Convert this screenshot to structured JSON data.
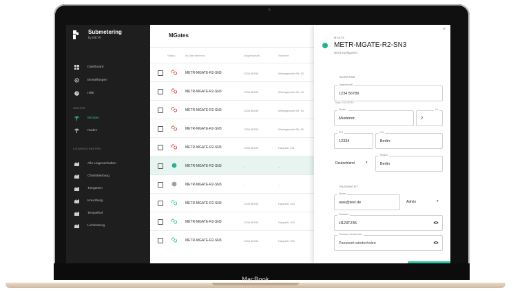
{
  "device": {
    "label": "MacBook"
  },
  "brand": {
    "title": "Submetering",
    "subtitle": "by METR"
  },
  "sidebar": {
    "items": [
      {
        "label": "Dashboard",
        "icon": "dashboard-icon"
      },
      {
        "label": "Einstellungen",
        "icon": "gear-icon"
      },
      {
        "label": "Hilfe",
        "icon": "help-icon"
      }
    ],
    "devices_section": "GERÄTE",
    "devices": [
      {
        "label": "MGates",
        "icon": "antenna-icon",
        "active": true
      },
      {
        "label": "Nodes",
        "icon": "antenna-icon",
        "active": false
      }
    ],
    "properties_section": "LIEGENSCHAFTEN",
    "properties": [
      {
        "label": "Alle Liegenschaften"
      },
      {
        "label": "Charlottenburg"
      },
      {
        "label": "Tiergarten"
      },
      {
        "label": "Kreuzberg"
      },
      {
        "label": "Tempelhof"
      },
      {
        "label": "Lichtenberg"
      }
    ]
  },
  "main": {
    "title": "MGates",
    "columns": {
      "status": "Status",
      "serial": "MGate Seriennr.",
      "property": "Liegenschaft",
      "location": "Standort"
    },
    "rows": [
      {
        "name": "METR-MGATE-R2-SN3",
        "property": "1234 56789",
        "location": "Wernigeroder Str. 13",
        "status": "link-red",
        "selected": false
      },
      {
        "name": "METR-MGATE-R2-SN3",
        "property": "1234 56789",
        "location": "Wernigeroder Str. 13",
        "status": "link-red",
        "selected": false
      },
      {
        "name": "METR-MGATE-R2-SN3",
        "property": "1234 56789",
        "location": "Wernigeroder Str. 14",
        "status": "link-red",
        "selected": false
      },
      {
        "name": "METR-MGATE-R2-SN3",
        "property": "1234 56789",
        "location": "Wernigeroder Str. 15",
        "status": "link-red",
        "selected": false
      },
      {
        "name": "METR-MGATE-R2-SN3",
        "property": "1234 56789",
        "location": "Hauptstr. 101",
        "status": "link-red",
        "selected": false
      },
      {
        "name": "METR-MGATE-R2-SN3",
        "property": "–",
        "location": "–",
        "status": "dot-green",
        "selected": true
      },
      {
        "name": "METR-MGATE-R2-SN3",
        "property": "–",
        "location": "–",
        "status": "dot-grey",
        "selected": false
      },
      {
        "name": "METR-MGATE-R2-SN3",
        "property": "1234 56789",
        "location": "Hauptstr. 220",
        "status": "link-green",
        "selected": false
      },
      {
        "name": "METR-MGATE-R2-SN3",
        "property": "1234 56789",
        "location": "Hauptstr. 102",
        "status": "link-green",
        "selected": false
      },
      {
        "name": "METR-MGATE-R2-SN3",
        "property": "1234 56789",
        "location": "Hauptstr. 222",
        "status": "link-green",
        "selected": false
      }
    ]
  },
  "panel": {
    "label": "MGATE",
    "title": "METR-MGATE-R2-SN3",
    "status": "Nicht konfiguriert",
    "address_section": "ADRESSE",
    "liegenschaft": {
      "label": "Liegenschaft",
      "value": "1234 56789",
      "hint": "Bspw. 1234 56789"
    },
    "strasse": {
      "label": "Straße",
      "value": "Musterstr."
    },
    "nr": {
      "label": "Nr",
      "value": "2"
    },
    "plz": {
      "label": "PLZ",
      "value": "12334"
    },
    "ort": {
      "label": "Ort",
      "value": "Berlin"
    },
    "land": {
      "value": "Deutschland"
    },
    "region": {
      "label": "Region",
      "value": "Berlin"
    },
    "password_section": "PASSWORT",
    "nutzer": {
      "label": "Nutzer",
      "value": "uwe@test.de"
    },
    "rolle": {
      "value": "Admin"
    },
    "passwort": {
      "label": "Passwort",
      "value": "H123TZ45"
    },
    "passwort2": {
      "label": "Passwort wiederholen",
      "value": "Passwort wiederholen"
    },
    "close": "×"
  },
  "colors": {
    "accent": "#2ec4a0",
    "error": "#e0443c",
    "sidebar": "#1e1e1e"
  }
}
